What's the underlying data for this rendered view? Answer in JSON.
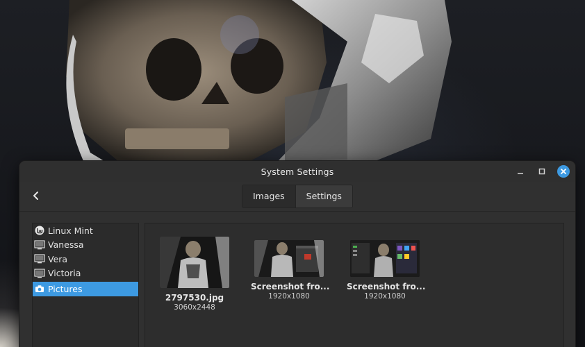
{
  "window": {
    "title": "System Settings",
    "controls": [
      "minimize-icon",
      "maximize-icon",
      "close-icon"
    ]
  },
  "toolbar": {
    "back_icon": "chevron-left-icon",
    "tabs": [
      {
        "label": "Images",
        "active": false
      },
      {
        "label": "Settings",
        "active": true
      }
    ]
  },
  "sidebar": {
    "items": [
      {
        "label": "Linux Mint",
        "icon": "linux-mint-logo-icon",
        "selected": false
      },
      {
        "label": "Vanessa",
        "icon": "monitor-icon",
        "selected": false
      },
      {
        "label": "Vera",
        "icon": "monitor-icon",
        "selected": false
      },
      {
        "label": "Victoria",
        "icon": "monitor-icon",
        "selected": false
      },
      {
        "label": "Pictures",
        "icon": "camera-icon",
        "selected": true
      }
    ]
  },
  "gallery": {
    "items": [
      {
        "name": "2797530.jpg",
        "dims": "3060x2448"
      },
      {
        "name": "Screenshot fro...",
        "dims": "1920x1080"
      },
      {
        "name": "Screenshot fro...",
        "dims": "1920x1080"
      }
    ]
  },
  "colors": {
    "accent": "#3d9ae2",
    "window_bg": "#303030",
    "panel_bg": "#2b2b2b"
  }
}
